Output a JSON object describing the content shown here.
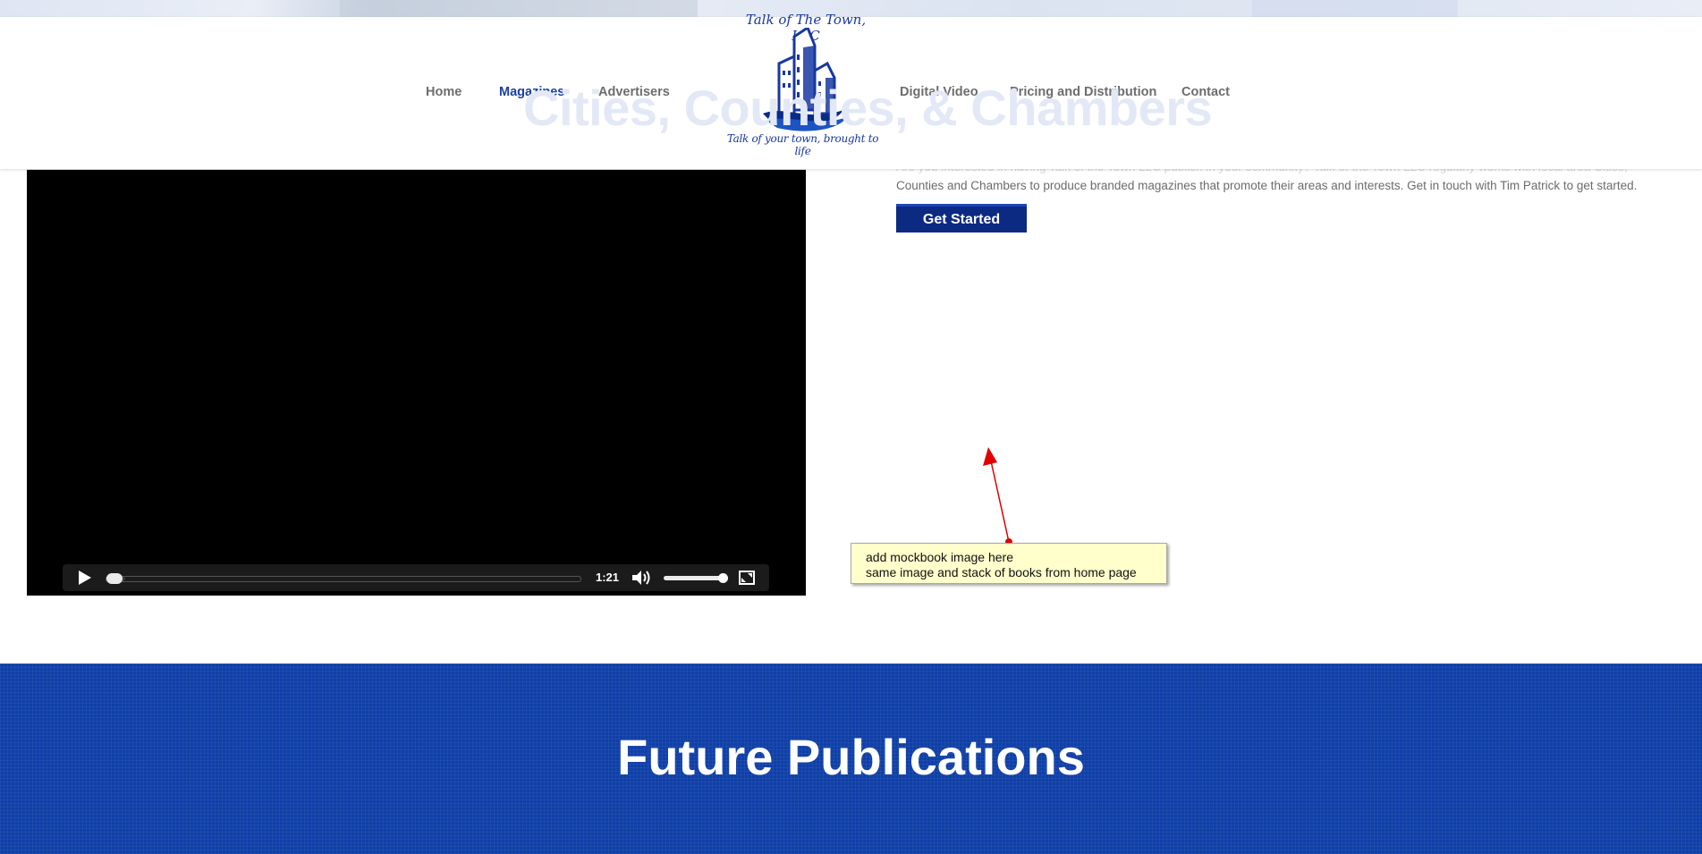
{
  "nav": {
    "left": [
      {
        "label": "Home",
        "active": false
      },
      {
        "label": "Magazines",
        "active": true
      },
      {
        "label": "Advertisers",
        "active": false
      }
    ],
    "right": [
      {
        "label": "Digital Video",
        "active": false
      },
      {
        "label": "Pricing and Distribution",
        "active": false
      },
      {
        "label": "Contact",
        "active": false
      }
    ]
  },
  "logo": {
    "title": "Talk of The Town, LLC",
    "tagline": "Talk of your town, brought to life"
  },
  "section": {
    "title": "Cities, Counties, & Chambers",
    "intro_faded": "Are you interested in having Talk of the Town LLC publish in your community? Talk of the Town LLC regularly works with local area Cities,",
    "intro_visible": "Counties and Chambers to produce branded magazines that promote their areas and interests. Get in touch with Tim Patrick to get started.",
    "cta_label": "Get Started"
  },
  "video": {
    "time": "1:21",
    "progress": 0.04,
    "volume": 1.0
  },
  "annotation": {
    "line1": "add mockbook image here",
    "line2": "same image and stack of books from home page"
  },
  "future": {
    "title": "Future Publications"
  },
  "colors": {
    "brand_blue": "#0f3fa7",
    "nav_active": "#1a3fa6",
    "button_bg": "#0c2a82",
    "note_bg": "#ffffcc",
    "arrow": "#e00000"
  }
}
